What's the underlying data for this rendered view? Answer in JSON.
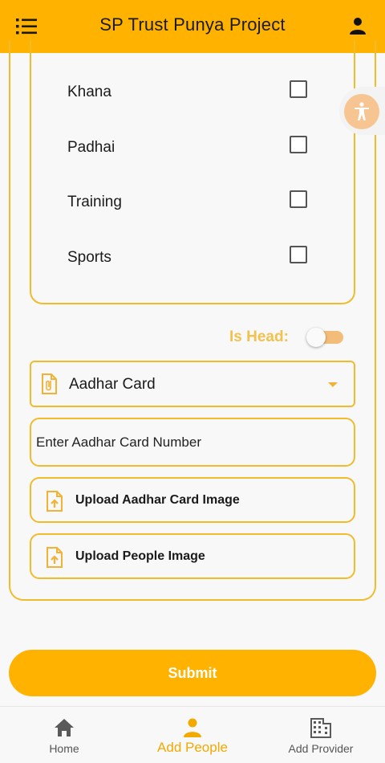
{
  "appbar": {
    "title": "SP Trust Punya Project",
    "menu_icon": "menu-icon",
    "user_icon": "user-icon"
  },
  "categories": [
    {
      "label": "Khana",
      "checked": false
    },
    {
      "label": "Padhai",
      "checked": false
    },
    {
      "label": "Training",
      "checked": false
    },
    {
      "label": "Sports",
      "checked": false
    }
  ],
  "is_head": {
    "label": "Is Head:",
    "on": false
  },
  "document": {
    "selected": "Aadhar Card",
    "icon": "paperclip-file-icon"
  },
  "aadhar_number": {
    "placeholder": "Enter Aadhar Card Number",
    "value": ""
  },
  "uploads": [
    {
      "label": "Upload Aadhar Card Image",
      "icon": "file-upload-icon"
    },
    {
      "label": "Upload People Image",
      "icon": "file-upload-icon"
    }
  ],
  "submit_label": "Submit",
  "bottom_nav": [
    {
      "label": "Home",
      "icon": "home-icon",
      "active": false
    },
    {
      "label": "Add People",
      "icon": "person-icon",
      "active": true
    },
    {
      "label": "Add Provider",
      "icon": "building-icon",
      "active": false
    }
  ],
  "colors": {
    "accent": "#ffb300",
    "border": "#f0bc2c",
    "is_head_text": "#f2c14e",
    "active_nav": "#f2a900"
  }
}
